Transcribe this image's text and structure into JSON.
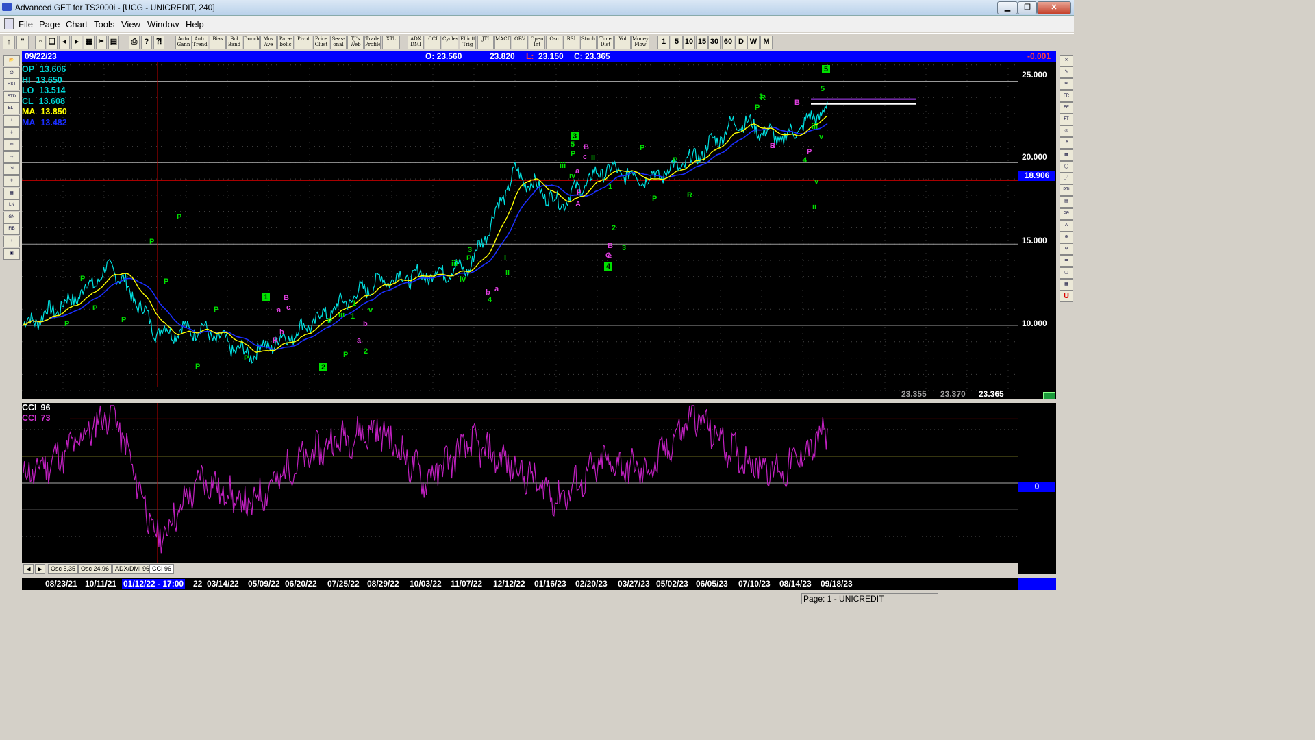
{
  "window": {
    "title": "Advanced GET for TS2000i - [UCG - UNICREDIT, 240]",
    "minimize": "▁",
    "restore": "❐",
    "close": "✕"
  },
  "menu": [
    "File",
    "Page",
    "Chart",
    "Tools",
    "View",
    "Window",
    "Help"
  ],
  "toolbar": {
    "studies": [
      {
        "id": "auto-gann",
        "label": "Auto Gann"
      },
      {
        "id": "auto-trend",
        "label": "Auto Trend"
      },
      {
        "id": "bias",
        "label": "Bias"
      },
      {
        "id": "bol-band",
        "label": "Bol Band"
      },
      {
        "id": "donch",
        "label": "Donch"
      },
      {
        "id": "mov-ave",
        "label": "Mov Ave"
      },
      {
        "id": "parabolic",
        "label": "Para-bolic"
      },
      {
        "id": "pivot",
        "label": "Pivot"
      },
      {
        "id": "price-clust",
        "label": "Price Clust"
      },
      {
        "id": "seasonal",
        "label": "Seas-onal"
      },
      {
        "id": "tjs-web",
        "label": "TJ's Web"
      },
      {
        "id": "trade-profile",
        "label": "Trade Profile"
      },
      {
        "id": "xtl",
        "label": "XTL"
      },
      {
        "id": "adx-dmi",
        "label": "ADX DMI"
      },
      {
        "id": "cci",
        "label": "CCI"
      },
      {
        "id": "cycles",
        "label": "Cycles"
      },
      {
        "id": "elliott-trig",
        "label": "Elliott Trig"
      },
      {
        "id": "jti",
        "label": "JTI"
      },
      {
        "id": "macd",
        "label": "MACD"
      },
      {
        "id": "obv",
        "label": "OBV"
      },
      {
        "id": "open-int",
        "label": "Open Int"
      },
      {
        "id": "osc",
        "label": "Osc"
      },
      {
        "id": "rsi",
        "label": "RSI"
      },
      {
        "id": "stoch",
        "label": "Stoch"
      },
      {
        "id": "time-dist",
        "label": "Time Dist"
      },
      {
        "id": "vol",
        "label": "Vol"
      },
      {
        "id": "money-flow",
        "label": "Money Flow"
      }
    ],
    "periods": [
      "1",
      "5",
      "10",
      "15",
      "30",
      "60",
      "D",
      "W",
      "M"
    ]
  },
  "left_tools": [
    "open",
    "print",
    "reset",
    "study",
    "elliott",
    "up",
    "down",
    "left",
    "right",
    "compress",
    "expand",
    "grid",
    "lines",
    "gann",
    "fib",
    "cross",
    "snapshot"
  ],
  "right_tools": [
    "close",
    "pen",
    "pencil",
    "fib-ret",
    "fib-ext",
    "fib-time",
    "cycle",
    "arrow",
    "grid",
    "ellipse",
    "fan",
    "pti",
    "table",
    "prob",
    "text",
    "zoom-in",
    "zoom-out",
    "list",
    "box",
    "calendar",
    "u"
  ],
  "info": {
    "date": "09/22/23",
    "open": "O: 23.560",
    "high": "23.820",
    "low_label": "L:",
    "low": "23.150",
    "close": "C: 23.365",
    "change": "-0.001"
  },
  "price_legend": [
    {
      "name": "OP",
      "value": "13.606",
      "color": "#00d8d8"
    },
    {
      "name": "HI",
      "value": "13.650",
      "color": "#00d8d8"
    },
    {
      "name": "LO",
      "value": "13.514",
      "color": "#00d8d8"
    },
    {
      "name": "CL",
      "value": "13.608",
      "color": "#00d8d8"
    },
    {
      "name": "MA",
      "value": "13.850",
      "color": "#ffff00"
    },
    {
      "name": "MA",
      "value": "13.482",
      "color": "#1a2eff"
    }
  ],
  "y_axis": {
    "ticks": [
      "25.000",
      "20.000",
      "15.000",
      "10.000"
    ],
    "current": "18.906"
  },
  "bottom_prices": [
    "23.355",
    "23.370",
    "23.365"
  ],
  "indicator_legend": [
    {
      "name": "CCI",
      "value": "96",
      "color": "#ffffff"
    },
    {
      "name": "CCI",
      "value": "73",
      "color": "#d030d0"
    }
  ],
  "indicator_axis": {
    "zero": "0"
  },
  "tabs": [
    "Osc 5,35",
    "Osc 24,96",
    "ADX/DMI 96",
    "CCI 96"
  ],
  "dates": [
    "08/23/21",
    "10/11/21",
    "01/12/22 - 17:00",
    "22",
    "03/14/22",
    "05/09/22",
    "06/20/22",
    "07/25/22",
    "08/29/22",
    "10/03/22",
    "11/07/22",
    "12/12/22",
    "01/16/23",
    "02/20/23",
    "03/27/23",
    "05/02/23",
    "06/05/23",
    "07/10/23",
    "08/14/23",
    "09/18/23"
  ],
  "status": "Page: 1 - UNICREDIT",
  "colors": {
    "price": "#00e0e0",
    "ma_fast": "#ffff00",
    "ma_slow": "#1a2eff",
    "cci": "#c020c0",
    "wave_green": "#00e000",
    "wave_magenta": "#e040e0",
    "hline_red": "#c00000"
  },
  "wave_labels": {
    "green": [
      "P",
      "P",
      "P",
      "P",
      "P",
      "P",
      "P",
      "P",
      "P",
      "1",
      "P",
      "P",
      "1",
      "P",
      "iii",
      "v",
      "2",
      "3",
      "P",
      "iii",
      "iv",
      "4",
      "i",
      "ii",
      "3",
      "5",
      "P",
      "iii",
      "iv",
      "ii",
      "1",
      "2",
      "P",
      "P",
      "P",
      "R",
      "R",
      "3",
      "P",
      "iii",
      "v",
      "ii",
      "4",
      "5",
      "v"
    ],
    "magenta": [
      "B",
      "c",
      "a",
      "b",
      "R",
      "a",
      "b",
      "a",
      "b",
      "B",
      "c",
      "a",
      "B",
      "c",
      "P",
      "A",
      "C",
      "R",
      "B",
      "B",
      "P"
    ],
    "boxed": [
      "1",
      "2",
      "3",
      "4",
      "5"
    ]
  },
  "chart_data": [
    {
      "type": "line",
      "title": "UCG - UNICREDIT, 240",
      "xlabel": "",
      "ylabel": "",
      "ylim": [
        5.5,
        26.2
      ],
      "x": [
        "08/23/21",
        "10/11/21",
        "01/12/22",
        "03/14/22",
        "05/09/22",
        "06/20/22",
        "07/25/22",
        "08/29/22",
        "10/03/22",
        "11/07/22",
        "12/12/22",
        "01/16/23",
        "02/20/23",
        "03/27/23",
        "05/02/23",
        "06/05/23",
        "07/10/23",
        "08/14/23",
        "09/18/23"
      ],
      "series": [
        {
          "name": "",
          "values": [
            10.0,
            11.4,
            13.6,
            9.6,
            9.8,
            8.2,
            9.4,
            11.1,
            12.8,
            13.1,
            13.6,
            19.4,
            17.5,
            19.6,
            19.0,
            20.2,
            22.6,
            21.4,
            23.4
          ]
        }
      ],
      "reference_lines": [
        25.0,
        20.0,
        18.906,
        15.0,
        10.0
      ],
      "grid": true,
      "legend": "top-left"
    },
    {
      "type": "line",
      "title": "CCI 96",
      "xlabel": "",
      "ylabel": "",
      "ylim": [
        -300,
        300
      ],
      "series": [
        {
          "name": "",
          "values": [
            20,
            120,
            280,
            -220,
            20,
            -90,
            60,
            160,
            200,
            10,
            150,
            60,
            -60,
            80,
            40,
            260,
            100,
            40,
            190
          ]
        }
      ],
      "reference_lines": [
        0
      ],
      "grid": true,
      "legend": "top-left"
    }
  ]
}
